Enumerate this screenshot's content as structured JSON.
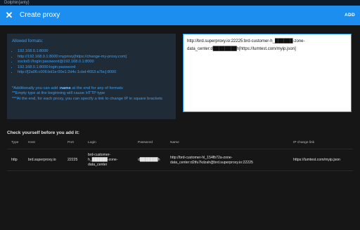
{
  "window": {
    "title": "Dolphin{anty}"
  },
  "header": {
    "title": "Create proxy",
    "add_label": "ADD",
    "close_glyph": "✕"
  },
  "formats": {
    "label": "Allowed formats:",
    "items": [
      "192.168.0.1:8000",
      "http://192.168.0.1:8000:myproxy[https://change-my-proxy.com]",
      "socks5://login:password@192.168.0.1:8000",
      "192.168.0.1:8000:login:password",
      "http://[2a06:c006:bd1e:00e1:2d4c:1cbd:4653:a7bc]:8000"
    ],
    "note1_prefix": "*Additionally you can add ",
    "note1_bold": ":name",
    "note1_suffix": " at the end for any of formats",
    "note2": "**Empty type at the beginning will cause HTTP type",
    "note3": "***At the end, for each proxy, you can specify a link to change IP in square brackets"
  },
  "input": {
    "value": "http://brd.superproxy.io:22225:brd-customer-h_██████-zone-data_center:d████████h[https://lumtest.com/myip.json]"
  },
  "check": {
    "title": "Check yourself before you add it:"
  },
  "table": {
    "headers": {
      "type": "Type",
      "host": "Host",
      "port": "Port",
      "login": "Login",
      "password": "Password",
      "name": "Name",
      "ip": "IP change link"
    },
    "row": {
      "type": "http",
      "host": "brd.superproxy.io",
      "port": "22225",
      "login": "brd-customer-h_██████-zone-data_center",
      "password": "d███████h",
      "name": "http://brd-customer-hl_154fb72a-zone-data_center:d2tfu7kdzah@brd.superproxy.io:22225",
      "ip": "https://lumtest.com/myip.json"
    }
  }
}
